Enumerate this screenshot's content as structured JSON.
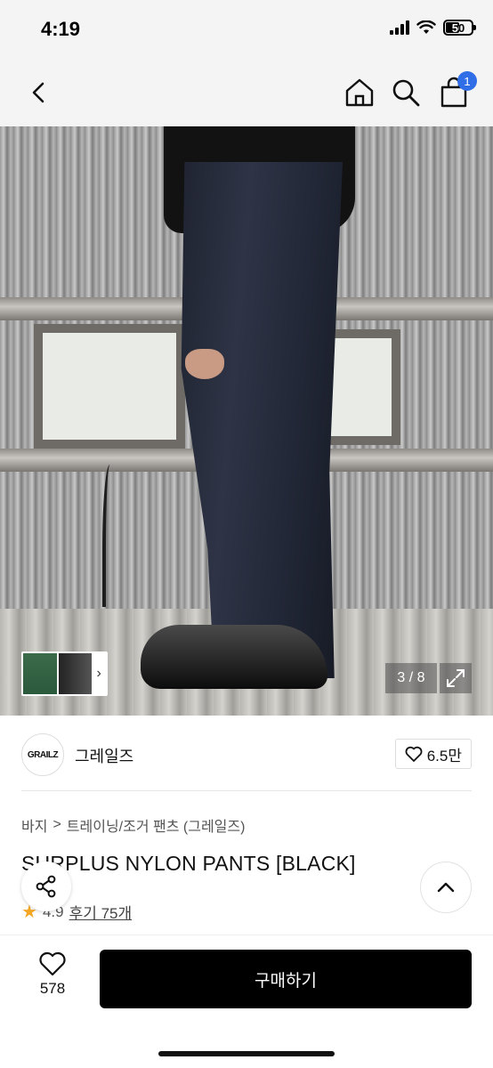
{
  "status_bar": {
    "time": "4:19",
    "battery": "50"
  },
  "nav": {
    "cart_count": "1"
  },
  "gallery": {
    "counter": "3 / 8"
  },
  "brand": {
    "logo_text": "GRAILZ",
    "name": "그레일즈",
    "likes": "6.5만"
  },
  "breadcrumb": {
    "level1": "바지",
    "separator": ">",
    "level2": "트레이닝/조거 팬츠 (그레일즈)"
  },
  "product": {
    "title": "SURPLUS NYLON PANTS [BLACK]",
    "rating": "4.9",
    "reviews": "후기 75개"
  },
  "bottom_bar": {
    "wish_count": "578",
    "buy_label": "구매하기"
  },
  "colors": {
    "accent_badge": "#2f6ee6",
    "rating_star": "#f5a623",
    "buy_button": "#000000"
  }
}
